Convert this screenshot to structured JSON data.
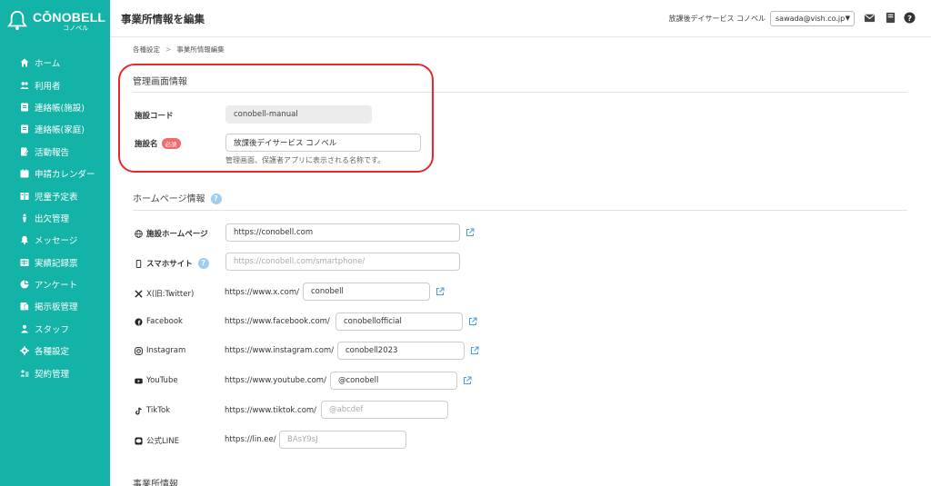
{
  "brand": {
    "name": "CŌNOBELL",
    "sub": "コノベル"
  },
  "nav": [
    {
      "label": "ホーム",
      "icon": "home-icon"
    },
    {
      "label": "利用者",
      "icon": "users-icon"
    },
    {
      "label": "連絡帳(施設)",
      "icon": "notebook-icon"
    },
    {
      "label": "連絡帳(家庭)",
      "icon": "notebook-icon"
    },
    {
      "label": "活動報告",
      "icon": "report-icon"
    },
    {
      "label": "申請カレンダー",
      "icon": "calendar-icon"
    },
    {
      "label": "児童予定表",
      "icon": "schedule-icon"
    },
    {
      "label": "出欠管理",
      "icon": "attendance-icon"
    },
    {
      "label": "メッセージ",
      "icon": "bell-icon"
    },
    {
      "label": "実績記録票",
      "icon": "table-icon"
    },
    {
      "label": "アンケート",
      "icon": "survey-icon"
    },
    {
      "label": "掲示板管理",
      "icon": "board-icon"
    },
    {
      "label": "スタッフ",
      "icon": "staff-icon"
    },
    {
      "label": "各種設定",
      "icon": "gear-icon"
    },
    {
      "label": "契約管理",
      "icon": "contract-icon"
    }
  ],
  "header": {
    "title": "事業所情報を編集",
    "facility": "放課後デイサービス コノベル",
    "account": "sawada@vish.co.jp"
  },
  "breadcrumb": {
    "parent": "各種設定",
    "sep": ">",
    "current": "事業所情報編集"
  },
  "admin": {
    "title": "管理画面情報",
    "code_label": "施設コード",
    "code_value": "conobell-manual",
    "name_label": "施設名",
    "required": "必須",
    "name_value": "放課後デイサービス コノベル",
    "name_hint": "管理画面、保護者アプリに表示される名称です。"
  },
  "homepage": {
    "title": "ホームページ情報",
    "help": "?",
    "site_label": "施設ホームページ",
    "site_value": "https://conobell.com",
    "smart_label": "スマホサイト",
    "smart_placeholder": "https://conobell.com/smartphone/",
    "x_label": "X(旧:Twitter)",
    "x_prefix": "https://www.x.com/",
    "x_value": "conobell",
    "fb_label": "Facebook",
    "fb_prefix": "https://www.facebook.com/",
    "fb_value": "conobellofficial",
    "ig_label": "Instagram",
    "ig_prefix": "https://www.instagram.com/",
    "ig_value": "conobell2023",
    "yt_label": "YouTube",
    "yt_prefix": "https://www.youtube.com/",
    "yt_value": "@conobell",
    "tt_label": "TikTok",
    "tt_prefix": "https://www.tiktok.com/",
    "tt_placeholder": "@abcdef",
    "line_label": "公式LINE",
    "line_prefix": "https://lin.ee/",
    "line_placeholder": "BAsY9sJ"
  },
  "office": {
    "title": "事業所情報"
  },
  "colors": {
    "sidebar": "#14b3a7",
    "highlight": "#e8282c",
    "required": "#f06b6b",
    "link": "#4a9be0"
  }
}
